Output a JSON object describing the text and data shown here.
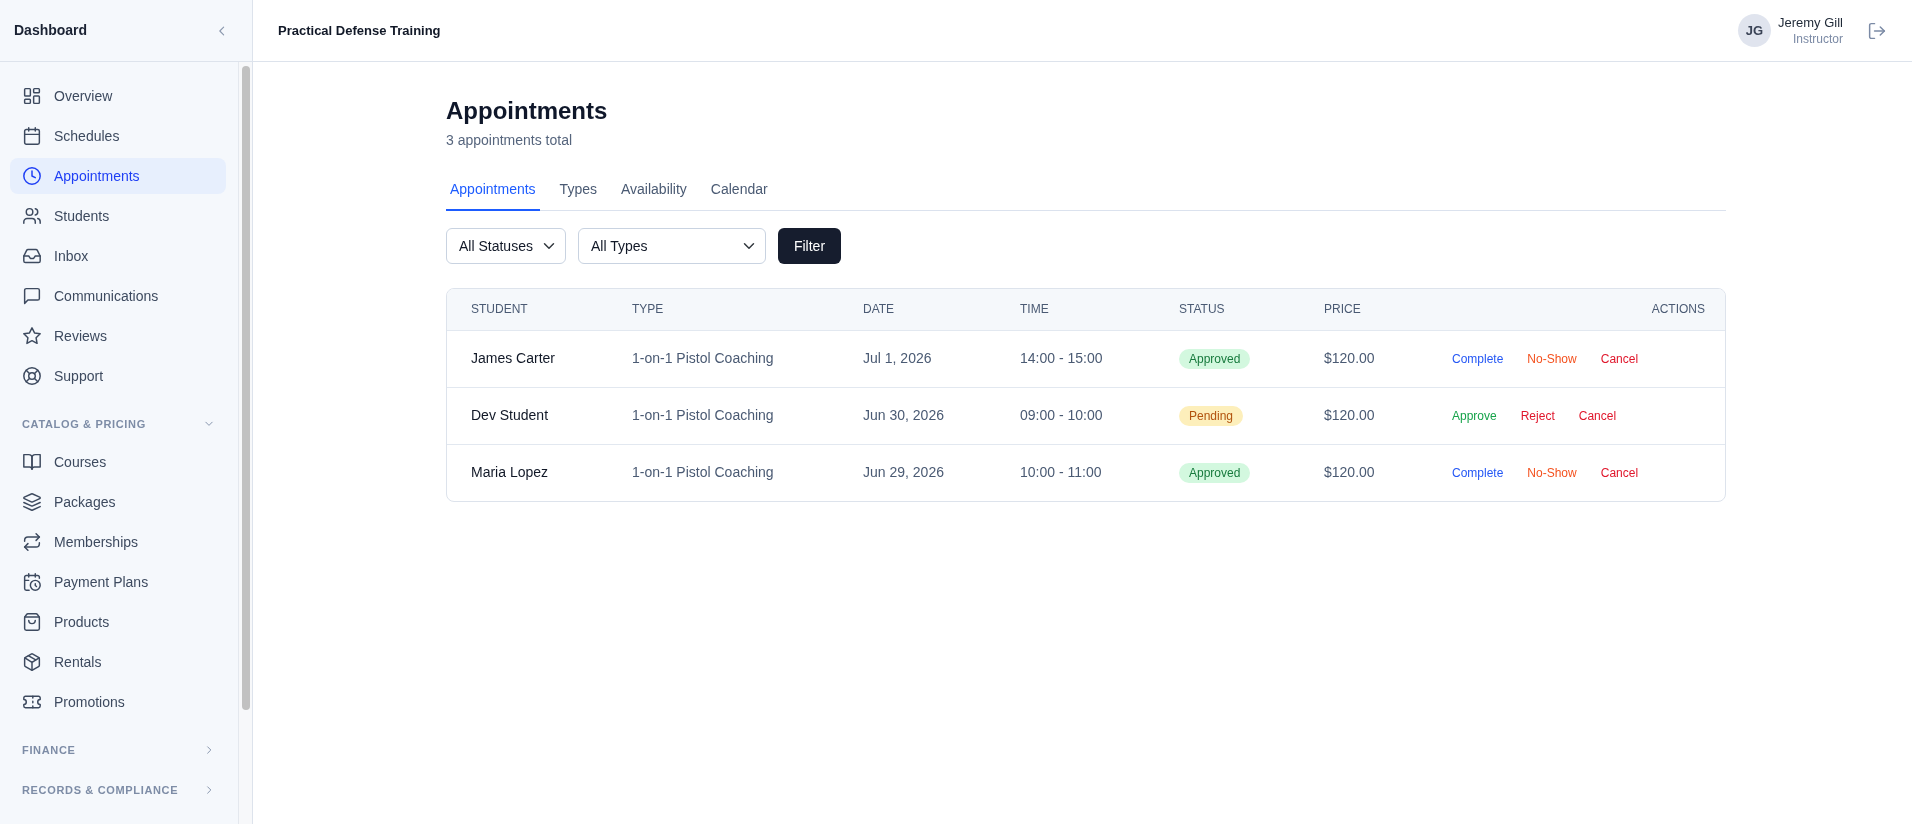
{
  "sidebar": {
    "title": "Dashboard",
    "items": [
      {
        "label": "Overview",
        "selected": false
      },
      {
        "label": "Schedules",
        "selected": false
      },
      {
        "label": "Appointments",
        "selected": true
      },
      {
        "label": "Students",
        "selected": false
      },
      {
        "label": "Inbox",
        "selected": false
      },
      {
        "label": "Communications",
        "selected": false
      },
      {
        "label": "Reviews",
        "selected": false
      },
      {
        "label": "Support",
        "selected": false
      }
    ],
    "sections": [
      {
        "title": "CATALOG & PRICING",
        "expanded": true,
        "items": [
          {
            "label": "Courses",
            "selected": false
          },
          {
            "label": "Packages",
            "selected": false
          },
          {
            "label": "Memberships",
            "selected": false
          },
          {
            "label": "Payment Plans",
            "selected": false
          },
          {
            "label": "Products",
            "selected": false
          },
          {
            "label": "Rentals",
            "selected": false
          },
          {
            "label": "Promotions",
            "selected": false
          }
        ]
      },
      {
        "title": "FINANCE",
        "expanded": false
      },
      {
        "title": "RECORDS & COMPLIANCE",
        "expanded": false
      }
    ]
  },
  "header": {
    "title": "Practical Defense Training",
    "user": {
      "initials": "JG",
      "name": "Jeremy Gill",
      "role": "Instructor"
    }
  },
  "page": {
    "title": "Appointments",
    "subtitle": "3 appointments total"
  },
  "tabs": [
    {
      "label": "Appointments",
      "selected": true
    },
    {
      "label": "Types",
      "selected": false
    },
    {
      "label": "Availability",
      "selected": false
    },
    {
      "label": "Calendar",
      "selected": false
    }
  ],
  "filters": {
    "status": "All Statuses",
    "type": "All Types",
    "button": "Filter"
  },
  "table": {
    "columns": [
      "STUDENT",
      "TYPE",
      "DATE",
      "TIME",
      "STATUS",
      "PRICE",
      "ACTIONS"
    ],
    "rows": [
      {
        "student": "James Carter",
        "type": "1-on-1 Pistol Coaching",
        "date": "Jul 1, 2026",
        "time": "14:00 - 15:00",
        "status": {
          "label": "Approved",
          "kind": "success"
        },
        "price": "$120.00",
        "actions": [
          {
            "label": "Complete",
            "color": "#2457f5"
          },
          {
            "label": "No-Show",
            "color": "#f4511e"
          },
          {
            "label": "Cancel",
            "color": "#e0162b"
          }
        ]
      },
      {
        "student": "Dev Student",
        "type": "1-on-1 Pistol Coaching",
        "date": "Jun 30, 2026",
        "time": "09:00 - 10:00",
        "status": {
          "label": "Pending",
          "kind": "warning"
        },
        "price": "$120.00",
        "actions": [
          {
            "label": "Approve",
            "color": "#16a34a"
          },
          {
            "label": "Reject",
            "color": "#e0162b"
          },
          {
            "label": "Cancel",
            "color": "#e0162b"
          }
        ]
      },
      {
        "student": "Maria Lopez",
        "type": "1-on-1 Pistol Coaching",
        "date": "Jun 29, 2026",
        "time": "10:00 - 11:00",
        "status": {
          "label": "Approved",
          "kind": "success"
        },
        "price": "$120.00",
        "actions": [
          {
            "label": "Complete",
            "color": "#2457f5"
          },
          {
            "label": "No-Show",
            "color": "#f4511e"
          },
          {
            "label": "Cancel",
            "color": "#e0162b"
          }
        ]
      }
    ]
  }
}
